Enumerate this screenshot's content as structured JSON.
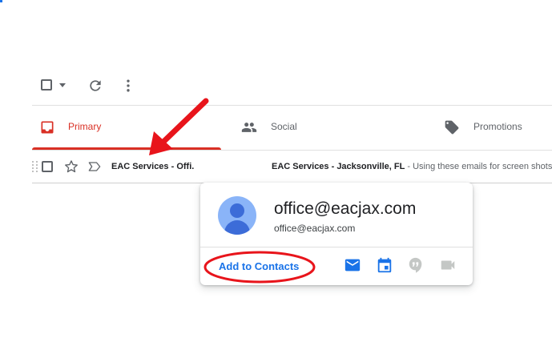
{
  "tabs": [
    {
      "label": "Primary",
      "icon": "inbox-icon"
    },
    {
      "label": "Social",
      "icon": "people-icon"
    },
    {
      "label": "Promotions",
      "icon": "tag-icon"
    }
  ],
  "email_row": {
    "sender": "EAC Services - Offi.",
    "subject": "EAC Services - Jacksonville, FL",
    "snippet": " - Using these emails for screen shots fo"
  },
  "contact_card": {
    "name": "office@eacjax.com",
    "email": "office@eacjax.com",
    "add_label": "Add to Contacts",
    "actions": [
      "email-icon",
      "calendar-icon",
      "hangouts-icon",
      "video-icon"
    ]
  },
  "colors": {
    "primary_tab": "#d93025",
    "link": "#1a73e8",
    "annotation": "#e8141b"
  }
}
